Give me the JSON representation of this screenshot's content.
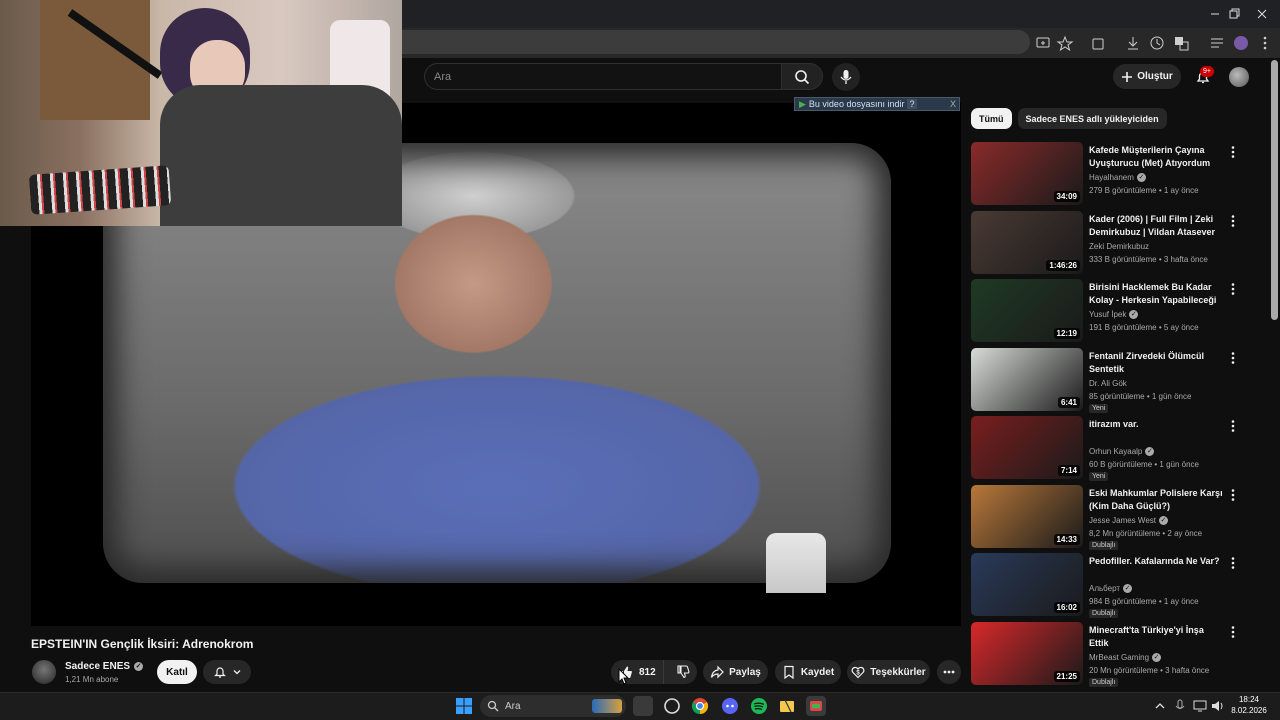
{
  "window": {
    "controls": [
      "minimize",
      "restore",
      "close"
    ]
  },
  "topbar": {
    "search_placeholder": "Ara",
    "create_label": "Oluştur",
    "notification_badge": "9+"
  },
  "download_banner": {
    "label": "Bu video dosyasını indir",
    "help": "?",
    "close": "X"
  },
  "video": {
    "title": "EPSTEIN'IN Gençlik İksiri: Adrenokrom",
    "channel": "Sadece ENES",
    "subscribers": "1,21 Mn abone",
    "join_label": "Katıl",
    "like_count": "812",
    "share_label": "Paylaş",
    "save_label": "Kaydet",
    "thanks_label": "Teşekkürler"
  },
  "sidebar": {
    "chips": [
      "Tümü",
      "Sadece ENES adlı yükleyiciden"
    ],
    "items": [
      {
        "title": "Kafede Müşterilerin Çayına Uyuşturucu (Met) Atıyordum",
        "channel": "Hayalhanem",
        "verified": true,
        "meta": "279 B görüntüleme • 1 ay önce",
        "duration": "34:09",
        "badge": "",
        "thumb_color": "#8a2a2a"
      },
      {
        "title": "Kader (2006) | Full Film | Zeki Demirkubuz | Vildan Atasever ...",
        "channel": "Zeki Demirkubuz",
        "verified": false,
        "meta": "333 B görüntüleme • 3 hafta önce",
        "duration": "1:46:26",
        "badge": "",
        "thumb_color": "#4a3a34"
      },
      {
        "title": "Birisini Hacklemek Bu Kadar Kolay - Herkesin Yapabileceği ...",
        "channel": "Yusuf İpek",
        "verified": true,
        "meta": "191 B görüntüleme • 5 ay önce",
        "duration": "12:19",
        "badge": "",
        "thumb_color": "#1f3a24"
      },
      {
        "title": "Fentanil Zirvedeki Ölümcül Sentetik",
        "channel": "Dr. Ali Gök",
        "verified": false,
        "meta": "85 görüntüleme • 1 gün önce",
        "duration": "6:41",
        "badge": "Yeni",
        "thumb_color": "#d8dcd8"
      },
      {
        "title": "itirazım var.",
        "channel": "Orhun Kayaalp",
        "verified": true,
        "meta": "60 B görüntüleme • 1 gün önce",
        "duration": "7:14",
        "badge": "Yeni",
        "thumb_color": "#7a1e1e"
      },
      {
        "title": "Eski Mahkumlar Polislere Karşı (Kim Daha Güçlü?)",
        "channel": "Jesse James West",
        "verified": true,
        "meta": "8,2 Mn görüntüleme • 2 ay önce",
        "duration": "14:33",
        "badge": "Dublajlı",
        "thumb_color": "#b8783a"
      },
      {
        "title": "Pedofiller. Kafalarında Ne Var?",
        "channel": "Альберт",
        "verified": true,
        "meta": "984 B görüntüleme • 1 ay önce",
        "duration": "16:02",
        "badge": "Dublajlı",
        "thumb_color": "#2a3a5a"
      },
      {
        "title": "Minecraft'ta Türkiye'yi İnşa Ettik",
        "channel": "MrBeast Gaming",
        "verified": true,
        "meta": "20 Mn görüntüleme • 3 hafta önce",
        "duration": "21:25",
        "badge": "Dublajlı",
        "thumb_color": "#d8282a"
      }
    ]
  },
  "taskbar": {
    "search_label": "Ara",
    "time": "18:24",
    "date": "8.02.2026"
  },
  "colors": {
    "accent_red": "#cc0000",
    "background": "#0f0f0f",
    "surface": "#272727"
  }
}
